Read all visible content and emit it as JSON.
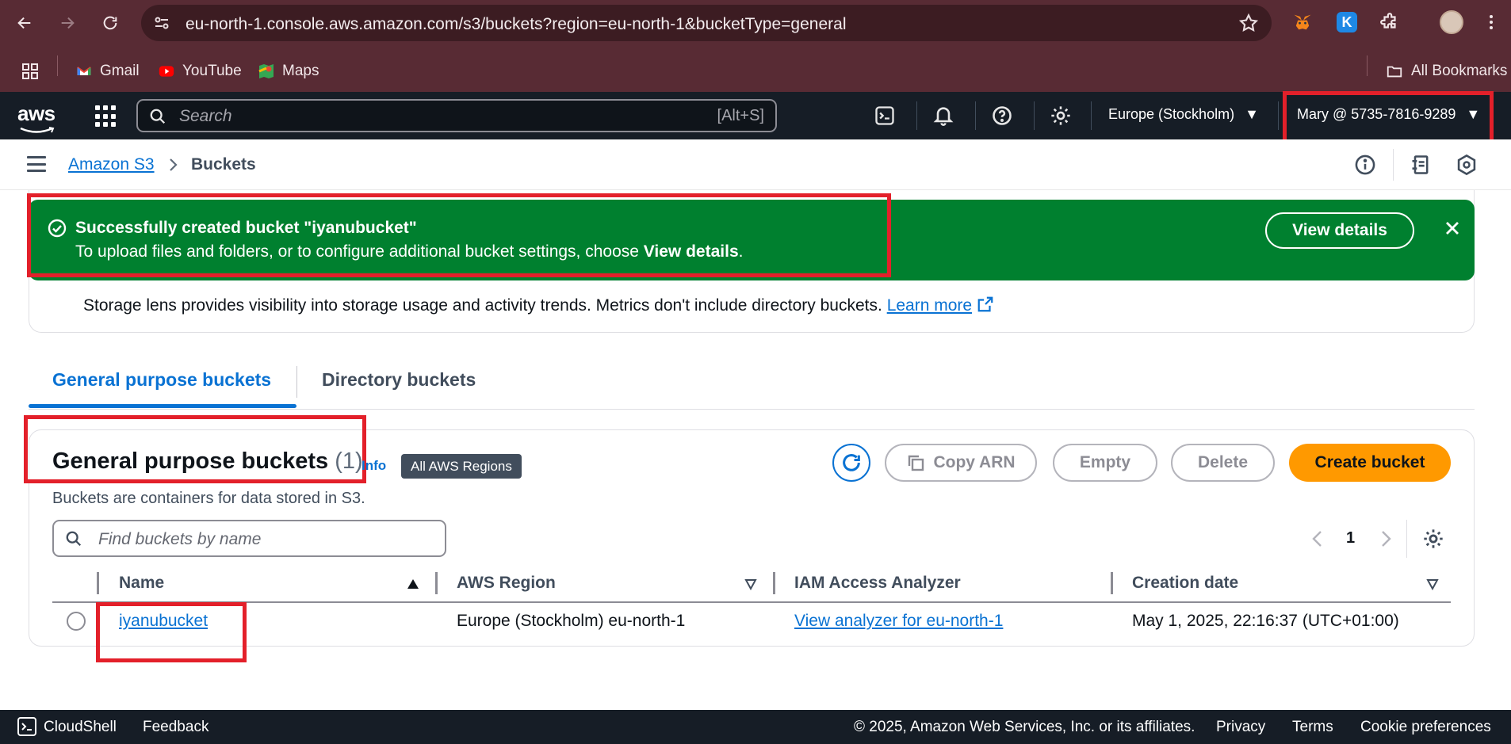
{
  "browser": {
    "url": "eu-north-1.console.aws.amazon.com/s3/buckets?region=eu-north-1&bucketType=general",
    "bookmarks": [
      {
        "label": "Gmail",
        "icon": "gmail-icon"
      },
      {
        "label": "YouTube",
        "icon": "youtube-icon"
      },
      {
        "label": "Maps",
        "icon": "maps-icon"
      }
    ],
    "all_bookmarks": "All Bookmarks"
  },
  "aws_nav": {
    "logo": "aws",
    "search_placeholder": "Search",
    "search_shortcut": "[Alt+S]",
    "region": "Europe (Stockholm)",
    "account": "Mary @ 5735-7816-9289"
  },
  "breadcrumb": {
    "root": "Amazon S3",
    "current": "Buckets"
  },
  "alert": {
    "title": "Successfully created bucket \"iyanubucket\"",
    "desc_prefix": "To upload files and folders, or to configure additional bucket settings, choose ",
    "desc_bold": "View details",
    "desc_suffix": ".",
    "button": "View details"
  },
  "storage_lens": {
    "text": "Storage lens provides visibility into storage usage and activity trends. Metrics don't include directory buckets.",
    "link": "Learn more"
  },
  "tabs": {
    "active": "General purpose buckets",
    "inactive": "Directory buckets"
  },
  "panel": {
    "title": "General purpose buckets",
    "count": "(1)",
    "info": "Info",
    "badge": "All AWS Regions",
    "description": "Buckets are containers for data stored in S3.",
    "buttons": {
      "copy_arn": "Copy ARN",
      "empty": "Empty",
      "delete": "Delete",
      "create": "Create bucket"
    },
    "find_placeholder": "Find buckets by name",
    "page": "1"
  },
  "table": {
    "columns": [
      "Name",
      "AWS Region",
      "IAM Access Analyzer",
      "Creation date"
    ],
    "rows": [
      {
        "name": "iyanubucket",
        "region": "Europe (Stockholm) eu-north-1",
        "analyzer": "View analyzer for eu-north-1",
        "created": "May 1, 2025, 22:16:37 (UTC+01:00)"
      }
    ]
  },
  "footer": {
    "cloudshell": "CloudShell",
    "feedback": "Feedback",
    "copyright": "© 2025, Amazon Web Services, Inc. or its affiliates.",
    "privacy": "Privacy",
    "terms": "Terms",
    "cookies": "Cookie preferences"
  },
  "colors": {
    "chrome": "#582b34",
    "aws_nav": "#161d26",
    "link": "#0972d3",
    "success": "#00802f",
    "primary_button": "#ff9900",
    "highlight": "#e3202a"
  }
}
